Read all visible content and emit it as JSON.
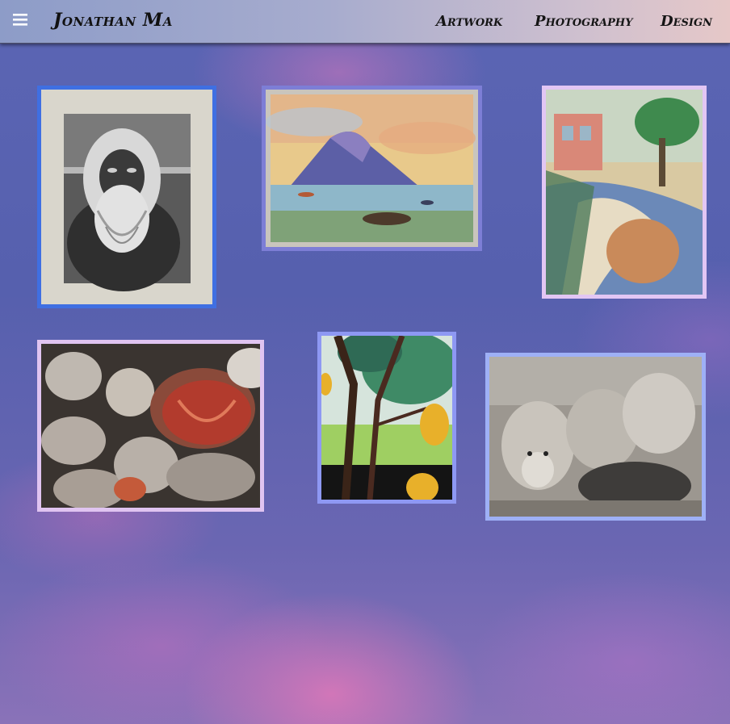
{
  "header": {
    "brand": "Jonathan Ma",
    "menu_icon": "hamburger-menu-icon",
    "nav": [
      {
        "label": "Artwork"
      },
      {
        "label": "Photography"
      },
      {
        "label": "Design"
      }
    ]
  },
  "gallery": {
    "tiles": [
      {
        "subject": "charcoal portrait of a bearded old man",
        "frame_color": "#3f6fe2"
      },
      {
        "subject": "pastel landscape of a mountain over a harbor with boats",
        "frame_color": "#7d7ed6"
      },
      {
        "subject": "pastel street scene with buildings, trees and a canal",
        "frame_color": "#e2c6f4"
      },
      {
        "subject": "close-up painting of sugared fruit",
        "frame_color": "#e0c4f1"
      },
      {
        "subject": "painting of a tree with yellow fruit",
        "frame_color": "#8e98f3"
      },
      {
        "subject": "pencil drawing of wolves",
        "frame_color": "#9eb0f6"
      }
    ]
  },
  "colors": {
    "header_gradient_start": "#8d9cc8",
    "header_gradient_end": "#e6c8c8",
    "background": "#5b65b4"
  }
}
